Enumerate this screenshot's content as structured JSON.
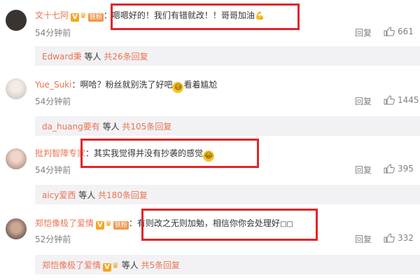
{
  "comments": [
    {
      "username": "文十七阿",
      "badge": "铁粉",
      "colon": "：",
      "text": "嗯嗯好的！我们有错就改！！哥哥加油",
      "time": "54分钟前",
      "reply": "回复",
      "likes": "661",
      "avatar_color": "#3a3330",
      "sub_user": "Edward秉",
      "sub_mid": " 等人 ",
      "sub_total": "共26条回复"
    },
    {
      "username": "Yue_Suki",
      "colon": "：",
      "text_a": "啊哈？粉丝就别洗了好吧",
      "text_b": "看着尴尬",
      "time": "54分钟前",
      "reply": "回复",
      "likes": "1445",
      "avatar_color": "#e8dcd6",
      "sub_user": "da_huang要有",
      "sub_mid": " 等人 ",
      "sub_total": "共105条回复"
    },
    {
      "username": "批判智障专家",
      "colon": "：",
      "text": "其实我觉得并没有抄袭的感觉",
      "time": "54分钟前",
      "reply": "回复",
      "likes": "395",
      "avatar_color": "#d9b9a8",
      "sub_user": "aicy爱西",
      "sub_mid": " 等人 ",
      "sub_total": "共180条回复"
    },
    {
      "username": "郑恺像极了爱情",
      "badge": "铁粉",
      "colon": "：",
      "text": "有则改之无则加勉，相信你你会处理好",
      "time": "52分钟前",
      "reply": "回复",
      "likes": "332",
      "avatar_color": "#6b5a50",
      "sub_user": "郑恺像极了爱情",
      "sub_mid": " 等人 ",
      "sub_total": "共5条回复"
    }
  ],
  "colors": {
    "username": "#eb7350",
    "highlight": "#e0262b",
    "sub_bg": "#f2f2f5",
    "muted": "#808080"
  },
  "icons": [
    "verified-v-icon",
    "crown-icon",
    "fan-badge",
    "thumb-up-icon",
    "emoji-icon"
  ]
}
